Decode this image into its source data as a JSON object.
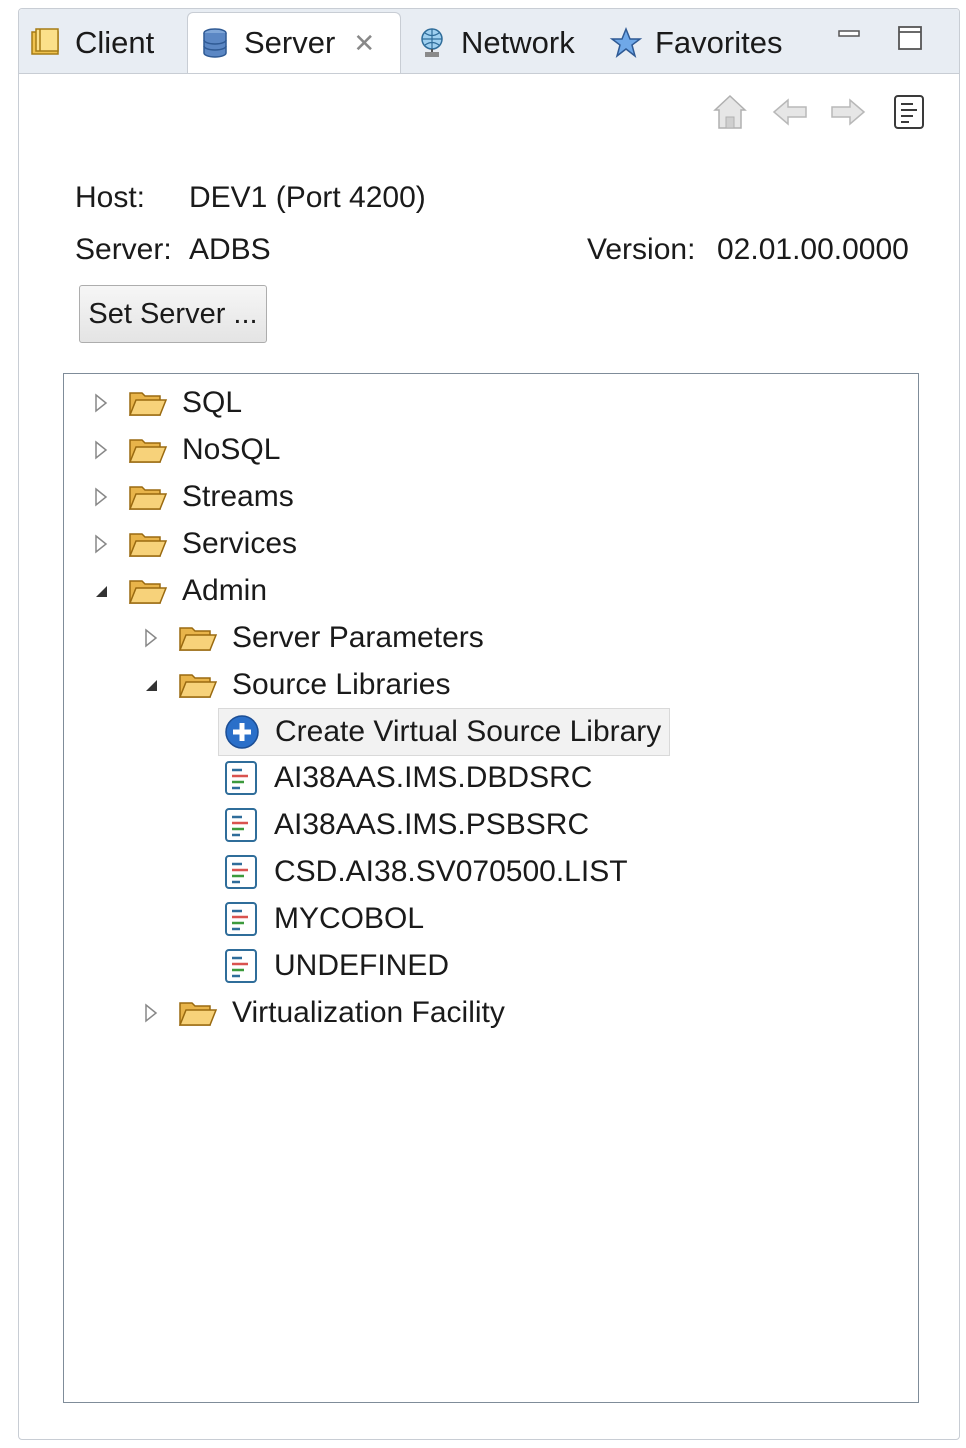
{
  "tabs": [
    {
      "label": "Client",
      "icon": "folder-book-icon"
    },
    {
      "label": "Server",
      "icon": "database-icon",
      "active": true
    },
    {
      "label": "Network",
      "icon": "globe-network-icon"
    },
    {
      "label": "Favorites",
      "icon": "star-icon"
    }
  ],
  "info": {
    "host_label": "Host:",
    "host_value": "DEV1 (Port 4200)",
    "server_label": "Server:",
    "server_value": "ADBS",
    "version_label": "Version:",
    "version_value": "02.01.00.0000"
  },
  "set_server_label": "Set Server ...",
  "tree": {
    "items": [
      {
        "label": "SQL"
      },
      {
        "label": "NoSQL"
      },
      {
        "label": "Streams"
      },
      {
        "label": "Services"
      },
      {
        "label": "Admin"
      },
      {
        "label": "Server Parameters"
      },
      {
        "label": "Source Libraries"
      },
      {
        "label": "Create Virtual Source Library"
      },
      {
        "label": "AI38AAS.IMS.DBDSRC"
      },
      {
        "label": "AI38AAS.IMS.PSBSRC"
      },
      {
        "label": "CSD.AI38.SV070500.LIST"
      },
      {
        "label": "MYCOBOL"
      },
      {
        "label": "UNDEFINED"
      },
      {
        "label": "Virtualization Facility"
      }
    ]
  },
  "colors": {
    "tabbar_bg": "#e8edf3",
    "folder": "#f3c35a",
    "add_blue": "#2a6fc9"
  }
}
